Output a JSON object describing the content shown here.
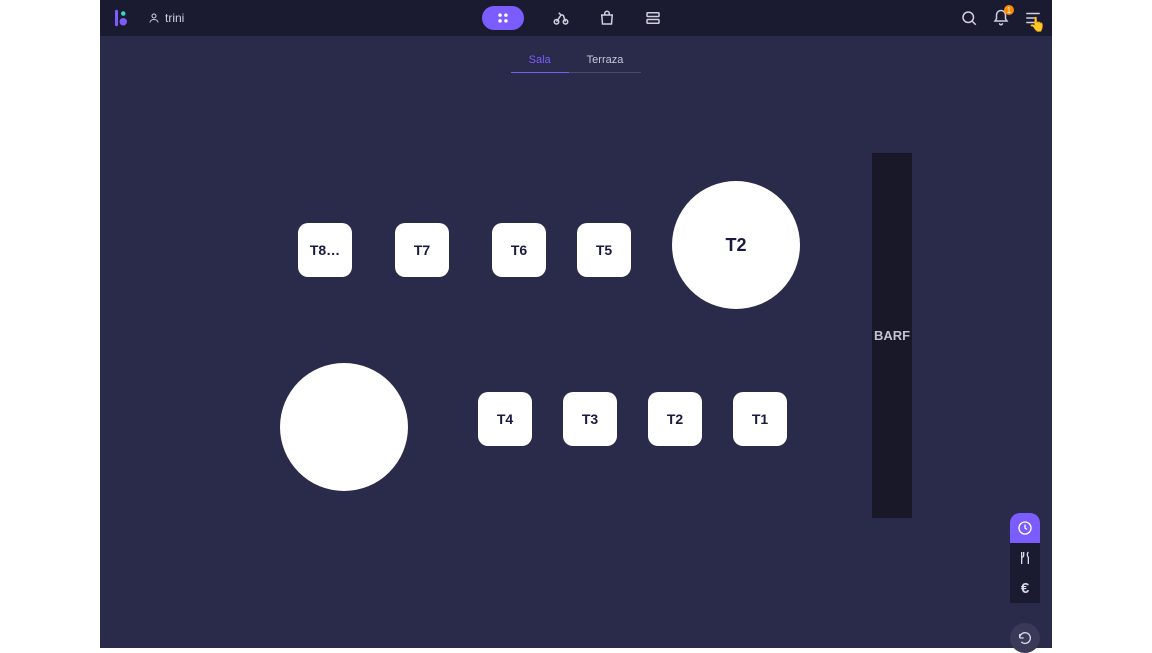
{
  "header": {
    "user_name": "trini",
    "notification_count": "1"
  },
  "tabs": [
    {
      "label": "Sala",
      "active": true
    },
    {
      "label": "Terraza",
      "active": false
    }
  ],
  "floor": {
    "squares_row1": [
      {
        "label": "T8…"
      },
      {
        "label": "T7"
      },
      {
        "label": "T6"
      },
      {
        "label": "T5"
      }
    ],
    "big_circle_top": {
      "label": "T2"
    },
    "big_circle_bottom": {
      "label": ""
    },
    "squares_row2": [
      {
        "label": "T4"
      },
      {
        "label": "T3"
      },
      {
        "label": "T2"
      },
      {
        "label": "T1"
      }
    ],
    "bar": {
      "label": "BARF"
    }
  },
  "colors": {
    "accent": "#7b5cff",
    "bg_dark": "#2a2a4a",
    "bg_darker": "#1a1a30"
  },
  "rail": {
    "euro_label": "€"
  }
}
